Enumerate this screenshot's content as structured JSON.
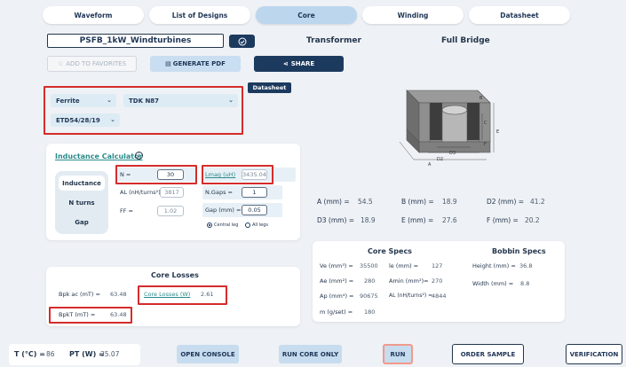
{
  "tabs": [
    {
      "label": "Waveform"
    },
    {
      "label": "List of Designs"
    },
    {
      "label": "Core",
      "active": true
    },
    {
      "label": "Winding"
    },
    {
      "label": "Datasheet"
    }
  ],
  "design": {
    "name": "PSFB_1kW_Windturbines",
    "type": "Transformer",
    "topology": "Full Bridge"
  },
  "actions": {
    "favorites": "ADD TO FAVORITES",
    "pdf": "GENERATE PDF",
    "share": "SHARE"
  },
  "material": {
    "type": "Ferrite",
    "vendor": "TDK N87",
    "core": "ETD54/28/19",
    "datasheet_btn": "Datasheet"
  },
  "inductance": {
    "title": "Inductance Calculator",
    "modes": [
      "Inductance",
      "N turns",
      "Gap"
    ],
    "n_label": "N =",
    "n_value": "30",
    "lmag_label": "Lmag (uH)",
    "lmag_value": "3435.04",
    "al_label": "AL (nH/turns²) =",
    "al_value": "3817",
    "ngaps_label": "N.Gaps =",
    "ngaps_value": "1",
    "ff_label": "FF =",
    "ff_value": "1.02",
    "gap_label": "Gap (mm) =",
    "gap_value": "0.05",
    "legs": [
      "Central leg",
      "All legs"
    ]
  },
  "dimensions": [
    {
      "label": "A (mm) =",
      "value": "54.5"
    },
    {
      "label": "B (mm) =",
      "value": "18.9"
    },
    {
      "label": "D2 (mm) =",
      "value": "41.2"
    },
    {
      "label": "D3 (mm) =",
      "value": "18.9"
    },
    {
      "label": "E (mm) =",
      "value": "27.6"
    },
    {
      "label": "F (mm) =",
      "value": "20.2"
    }
  ],
  "core_specs": {
    "title": "Core Specs",
    "rows": [
      {
        "label": "Ve (mm³) =",
        "value": "35500"
      },
      {
        "label": "Ae (mm²) =",
        "value": "280"
      },
      {
        "label": "Ap (mm⁴) =",
        "value": "90675"
      },
      {
        "label": "m (g/set) =",
        "value": "180"
      }
    ],
    "rows2": [
      {
        "label": "le (mm) =",
        "value": "127"
      },
      {
        "label": "Amin (mm²)=",
        "value": "270"
      },
      {
        "label": "AL (nH/turns²) =",
        "value": "4844"
      }
    ]
  },
  "bobbin_specs": {
    "title": "Bobbin Specs",
    "rows": [
      {
        "label": "Height (mm) =",
        "value": "36.8"
      },
      {
        "label": "Width (mm) =",
        "value": "8.8"
      }
    ]
  },
  "core_losses": {
    "title": "Core Losses",
    "bpk_ac_label": "Bpk ac (mT) =",
    "bpk_ac_value": "63.48",
    "losses_label": "Core Losses (W)",
    "losses_value": "2.61",
    "bpkt_label": "BpkT (mT) =",
    "bpkt_value": "63.48"
  },
  "footer": {
    "t_label": "T (°C) =",
    "t_value": "86",
    "pt_label": "PT (W) =",
    "pt_value": "35.07",
    "open_console": "OPEN CONSOLE",
    "run_core_only": "RUN CORE ONLY",
    "run": "RUN",
    "order_sample": "ORDER SAMPLE",
    "verification": "VERIFICATION"
  },
  "diagram_labels": [
    "B",
    "C",
    "D3",
    "D2",
    "A",
    "E",
    "F"
  ],
  "colors": {
    "primary": "#1c3a5e",
    "accent_light": "#bcd6ee",
    "highlight_red": "#d42c2c",
    "run_border": "#f19a8c"
  }
}
